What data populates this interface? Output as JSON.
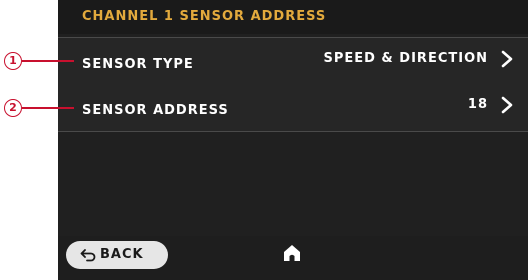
{
  "header": {
    "title": "CHANNEL 1 SENSOR ADDRESS"
  },
  "rows": [
    {
      "label": "SENSOR TYPE",
      "value": "SPEED & DIRECTION"
    },
    {
      "label": "SENSOR ADDRESS",
      "value": "18"
    }
  ],
  "footer": {
    "back_label": "BACK"
  },
  "callouts": [
    "1",
    "2"
  ],
  "icons": {
    "chevron": "chevron-right-icon",
    "back": "back-arrow-icon",
    "home": "home-icon"
  },
  "colors": {
    "accent": "#e3aa3d",
    "screen_bg": "#202020",
    "callout": "#c8102e"
  }
}
